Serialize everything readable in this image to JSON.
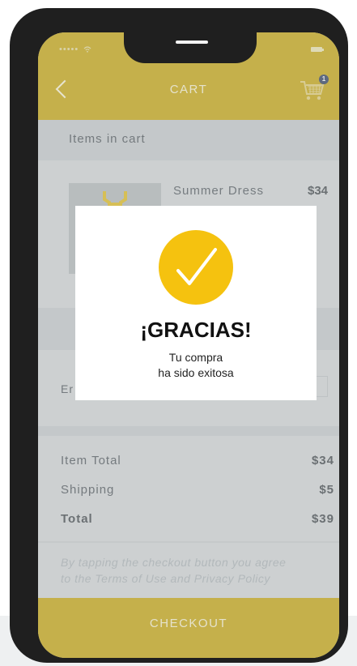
{
  "status_bar": {
    "signal": "•••••",
    "wifi_icon": "wifi-icon",
    "battery_icon": "battery-icon"
  },
  "header": {
    "title": "CART",
    "back_icon": "chevron-left-icon",
    "cart_icon": "shopping-cart-icon",
    "cart_count": "1"
  },
  "items_section": {
    "label": "Items in cart"
  },
  "product": {
    "name": "Summer Dress",
    "price": "$34",
    "thumb_icon": "dress-icon"
  },
  "email": {
    "label_partial": "Er"
  },
  "summary": {
    "item_total_label": "Item Total",
    "item_total_value": "$34",
    "shipping_label": "Shipping",
    "shipping_value": "$5",
    "total_label": "Total",
    "total_value": "$39"
  },
  "terms": {
    "line1": "By tapping the checkout button you agree",
    "line2": "to the Terms of Use and Privacy Policy"
  },
  "checkout": {
    "label": "CHECKOUT"
  },
  "modal": {
    "icon": "check-icon",
    "title": "¡GRACIAS!",
    "message_line1": "Tu compra",
    "message_line2": "ha sido exitosa"
  },
  "colors": {
    "accent": "#c9a70a",
    "check": "#f5c20f",
    "frame": "#1f1f1f",
    "screen_bg": "#d6d8d8"
  }
}
